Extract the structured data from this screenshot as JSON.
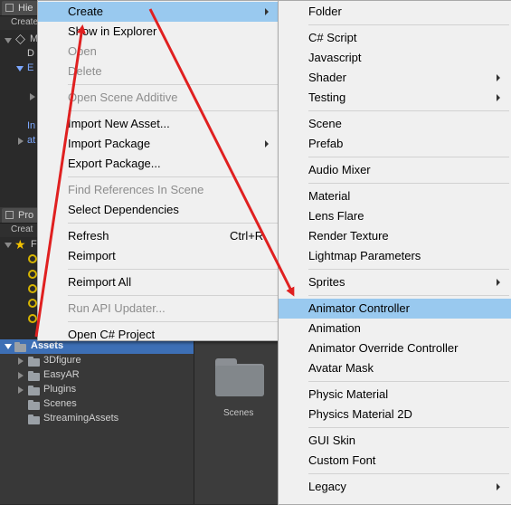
{
  "hierarchy": {
    "tab_label": "Hie",
    "create_label": "Create",
    "items": [
      "M",
      "D",
      "E",
      "In",
      "at"
    ]
  },
  "project": {
    "tab_label": "Pro",
    "create_label": "Creat",
    "favorites_label": "F",
    "assets_label": "Assets",
    "folders": [
      "3Dfigure",
      "EasyAR",
      "Plugins",
      "Scenes",
      "StreamingAssets"
    ],
    "grid_item_label": "Scenes"
  },
  "context_menu": {
    "items": [
      {
        "label": "Create",
        "state": "highlighted",
        "submenu": true
      },
      {
        "label": "Show in Explorer"
      },
      {
        "label": "Open",
        "state": "disabled"
      },
      {
        "label": "Delete",
        "state": "disabled"
      },
      {
        "label": "Open Scene Additive",
        "state": "disabled"
      },
      {
        "label": "Import New Asset..."
      },
      {
        "label": "Import Package",
        "submenu": true
      },
      {
        "label": "Export Package..."
      },
      {
        "label": "Find References In Scene",
        "state": "disabled"
      },
      {
        "label": "Select Dependencies"
      },
      {
        "label": "Refresh",
        "shortcut": "Ctrl+R"
      },
      {
        "label": "Reimport"
      },
      {
        "label": "Reimport All"
      },
      {
        "label": "Run API Updater...",
        "state": "disabled"
      },
      {
        "label": "Open C# Project"
      }
    ]
  },
  "create_submenu": {
    "items": [
      {
        "label": "Folder"
      },
      {
        "label": "C# Script"
      },
      {
        "label": "Javascript"
      },
      {
        "label": "Shader",
        "submenu": true
      },
      {
        "label": "Testing",
        "submenu": true
      },
      {
        "label": "Scene"
      },
      {
        "label": "Prefab"
      },
      {
        "label": "Audio Mixer"
      },
      {
        "label": "Material"
      },
      {
        "label": "Lens Flare"
      },
      {
        "label": "Render Texture"
      },
      {
        "label": "Lightmap Parameters"
      },
      {
        "label": "Sprites",
        "submenu": true
      },
      {
        "label": "Animator Controller",
        "state": "highlighted"
      },
      {
        "label": "Animation"
      },
      {
        "label": "Animator Override Controller"
      },
      {
        "label": "Avatar Mask"
      },
      {
        "label": "Physic Material"
      },
      {
        "label": "Physics Material 2D"
      },
      {
        "label": "GUI Skin"
      },
      {
        "label": "Custom Font"
      },
      {
        "label": "Legacy",
        "submenu": true
      }
    ]
  },
  "colors": {
    "menu_bg": "#f0f0f0",
    "highlight": "#99c9ef",
    "annotation_arrow": "#e02020",
    "selection": "#3d6fb5"
  }
}
